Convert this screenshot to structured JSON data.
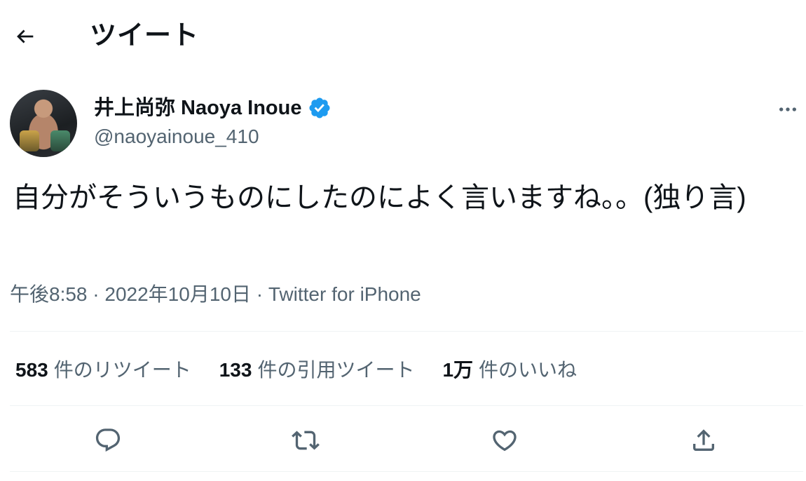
{
  "header": {
    "title": "ツイート"
  },
  "author": {
    "display_name": "井上尚弥 Naoya Inoue",
    "handle": "@naoyainoue_410",
    "verified": true
  },
  "tweet": {
    "text": "自分がそういうものにしたのによく言いますね。。(独り言)",
    "time": "午後8:58",
    "date": "2022年10月10日",
    "separator": "·",
    "source": "Twitter for iPhone"
  },
  "stats": {
    "retweets": {
      "count": "583",
      "label": "件のリツイート"
    },
    "quotes": {
      "count": "133",
      "label": "件の引用ツイート"
    },
    "likes": {
      "count": "1万",
      "label": "件のいいね"
    }
  },
  "colors": {
    "text_primary": "#0f1419",
    "text_secondary": "#536471",
    "verified_blue": "#1d9bf0",
    "divider": "#eff3f4"
  },
  "icons": {
    "back": "arrow-left-icon",
    "verified": "verified-badge-icon",
    "more": "more-horizontal-icon",
    "reply": "reply-icon",
    "retweet": "retweet-icon",
    "like": "heart-icon",
    "share": "share-icon"
  }
}
